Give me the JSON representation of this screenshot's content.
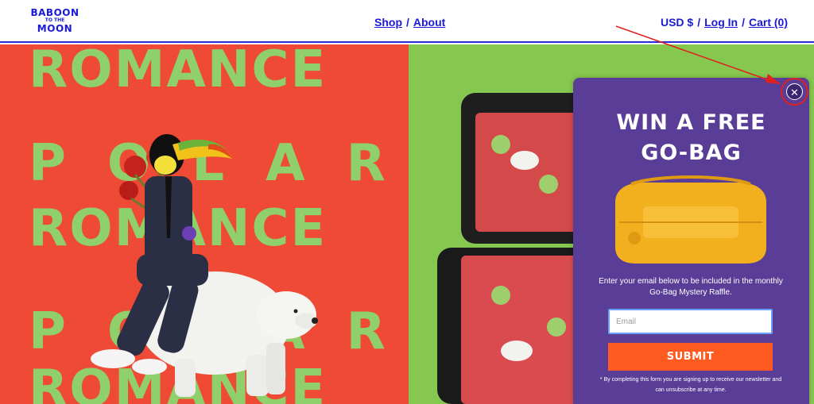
{
  "header": {
    "logo": {
      "line1": "BABOON",
      "line2": "TO THE",
      "line3": "MOON"
    },
    "nav": {
      "shop": "Shop",
      "separator": "/",
      "about": "About"
    },
    "account": {
      "currency": "USD $",
      "separator": "/",
      "login": "Log In",
      "cart": "Cart (0)"
    }
  },
  "hero": {
    "words": [
      "ROMANCE",
      "POLAR",
      "ROMANCE",
      "POLAR",
      "ROMANCE"
    ]
  },
  "popup": {
    "title_line1": "WIN A FREE",
    "title_line2": "GO-BAG",
    "description": "Enter your email below to be included in the monthly Go-Bag Mystery Raffle.",
    "email_placeholder": "Email",
    "submit_label": "SUBMIT",
    "fineprint": "* By completing this form you are signing up to receive our newsletter and can unsubscribe at any time.",
    "close_symbol": "✕"
  },
  "colors": {
    "brand_blue": "#1a1ad6",
    "hero_red": "#ee4a36",
    "hero_green": "#86c84f",
    "word_green": "#8fd06a",
    "popup_purple": "#5a3d96",
    "submit_orange": "#ff5a1f",
    "bag_yellow": "#f2b01e",
    "annotation_red": "#e0201e"
  },
  "icons": {
    "close": "close-icon",
    "annotation": "annotation-arrow-icon"
  }
}
